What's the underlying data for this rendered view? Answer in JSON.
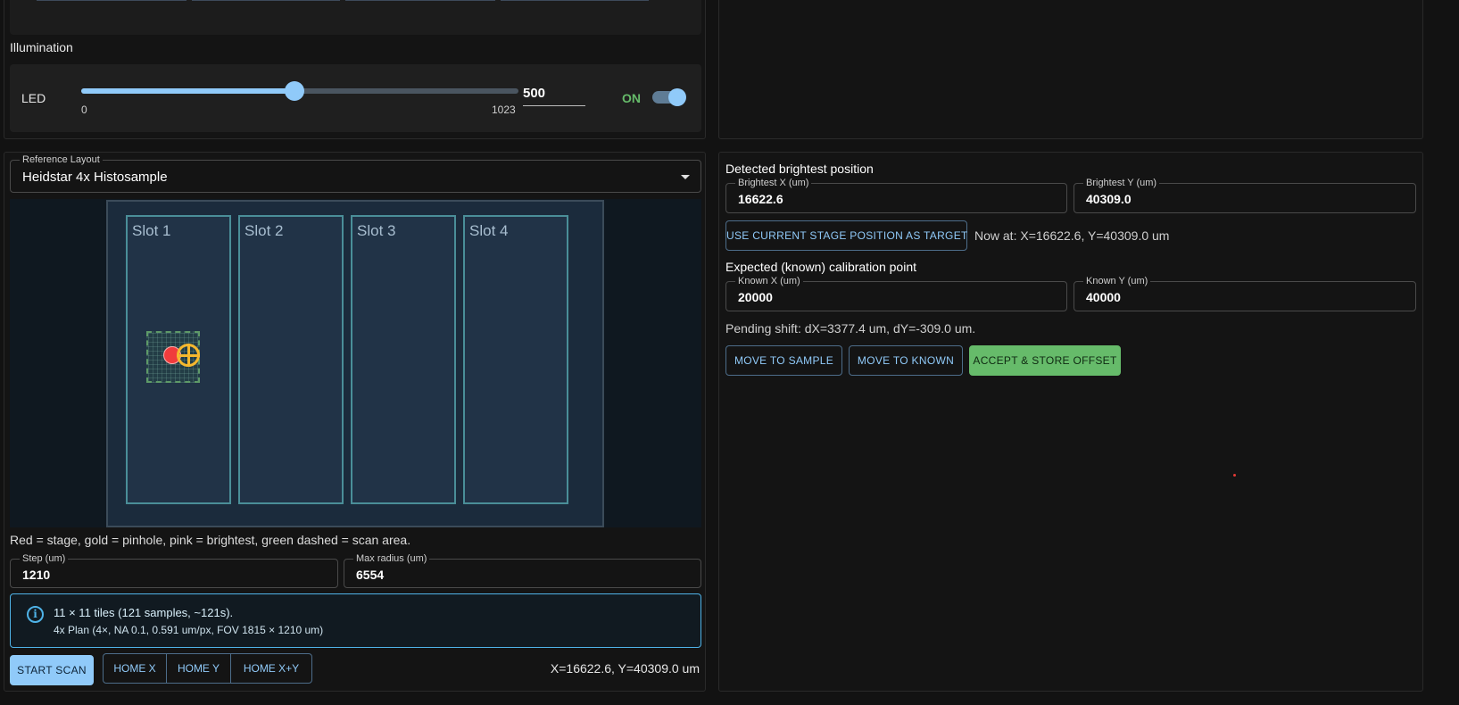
{
  "illumination": {
    "section_label": "Illumination",
    "led_label": "LED",
    "slider": {
      "min": 0,
      "max": 1023,
      "value": 500,
      "min_label": "0",
      "max_label": "1023"
    },
    "value_text": "500",
    "toggle_label": "ON",
    "toggle_on": true
  },
  "reference_layout": {
    "legend": "Reference Layout",
    "selected": "Heidstar 4x Histosample",
    "slots": [
      {
        "label": "Slot 1"
      },
      {
        "label": "Slot 2"
      },
      {
        "label": "Slot 3"
      },
      {
        "label": "Slot 4"
      }
    ],
    "legend_text": "Red = stage, gold = pinhole, pink = brightest, green dashed = scan area."
  },
  "scan_params": {
    "step": {
      "label": "Step (um)",
      "value": "1210"
    },
    "max_radius": {
      "label": "Max radius (um)",
      "value": "6554"
    }
  },
  "info": {
    "icon": "info-icon",
    "line1": "11 × 11 tiles (121 samples, ~121s).",
    "line2": "4x Plan (4×, NA 0.1, 0.591 um/px, FOV 1815 × 1210 um)"
  },
  "actions": {
    "start_scan": "START SCAN",
    "home_x": "HOME X",
    "home_y": "HOME Y",
    "home_xy": "HOME X+Y",
    "position": "X=16622.6, Y=40309.0 um"
  },
  "calibration": {
    "detected_heading": "Detected brightest position",
    "brightest_x": {
      "label": "Brightest X (um)",
      "value": "16622.6"
    },
    "brightest_y": {
      "label": "Brightest Y (um)",
      "value": "40309.0"
    },
    "use_current_button": "USE CURRENT STAGE POSITION AS TARGET",
    "now_at": "Now at: X=16622.6, Y=40309.0 um",
    "expected_heading": "Expected (known) calibration point",
    "known_x": {
      "label": "Known X (um)",
      "value": "20000"
    },
    "known_y": {
      "label": "Known Y (um)",
      "value": "40000"
    },
    "pending": "Pending shift: dX=3377.4 um, dY=-309.0 um.",
    "move_to_sample": "MOVE TO SAMPLE",
    "move_to_known": "MOVE TO KNOWN",
    "accept_store": "ACCEPT & STORE OFFSET"
  },
  "colors": {
    "accent": "#90caf9",
    "success": "#66bb6a",
    "info": "#4fb3e8",
    "stage": "#f03c3c",
    "pinhole": "#f5b82e",
    "scan_area": "#5e9a68"
  }
}
